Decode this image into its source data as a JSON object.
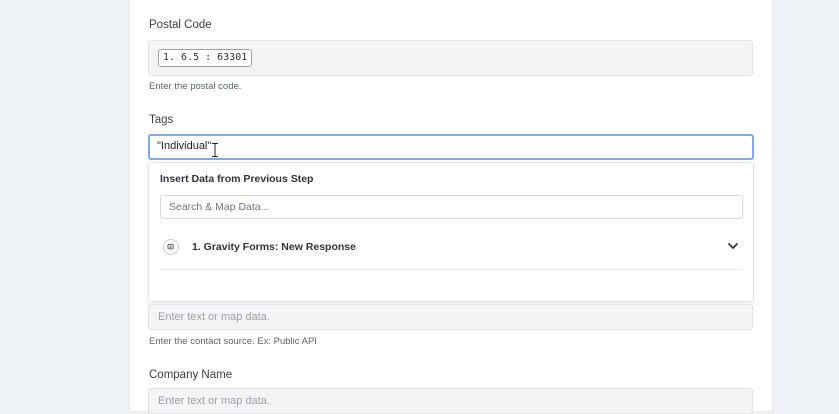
{
  "postal_code": {
    "label": "Postal Code",
    "mapped_value": "1. 6.5 : 63301",
    "help": "Enter the postal code."
  },
  "tags": {
    "label": "Tags",
    "value": "\"Individual\""
  },
  "dropdown": {
    "heading": "Insert Data from Previous Step",
    "search_placeholder": "Search & Map Data...",
    "step_label": "1. Gravity Forms: New Response"
  },
  "contact_source": {
    "placeholder": "Enter text or map data.",
    "help": "Enter the contact source. Ex: Public API"
  },
  "company_name": {
    "label": "Company Name",
    "placeholder": "Enter text or map data."
  },
  "colors": {
    "focus_border": "#7ba9ea",
    "field_bg": "#f3f4f6"
  }
}
